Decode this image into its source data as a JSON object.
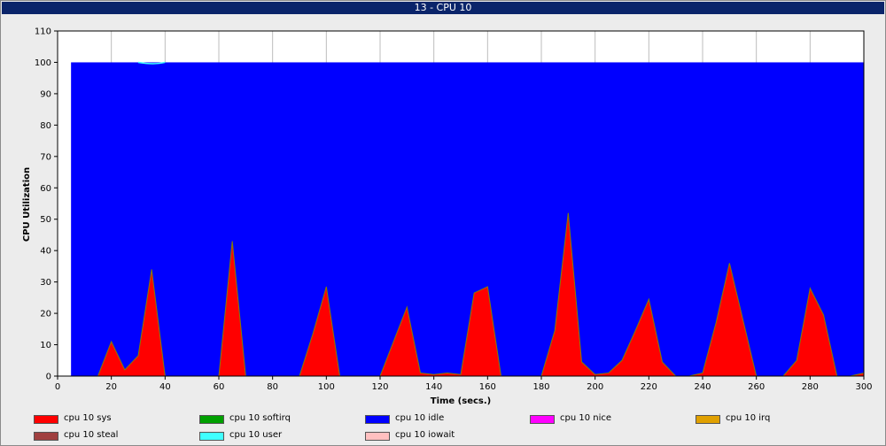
{
  "window": {
    "title": "13 - CPU 10"
  },
  "chart_data": {
    "type": "area",
    "title": "",
    "xlabel": "Time (secs.)",
    "ylabel": "CPU Utilization",
    "xlim": [
      0,
      300
    ],
    "ylim": [
      0,
      110
    ],
    "xticks": [
      0,
      20,
      40,
      60,
      80,
      100,
      120,
      140,
      160,
      180,
      200,
      220,
      240,
      260,
      280,
      300
    ],
    "yticks": [
      0,
      10,
      20,
      30,
      40,
      50,
      60,
      70,
      80,
      90,
      100,
      110
    ],
    "grid": true,
    "legend_position": "bottom",
    "x": [
      5,
      10,
      15,
      20,
      25,
      30,
      35,
      40,
      45,
      50,
      55,
      60,
      65,
      70,
      75,
      80,
      85,
      90,
      95,
      100,
      105,
      110,
      115,
      120,
      125,
      130,
      135,
      140,
      145,
      150,
      155,
      160,
      165,
      170,
      175,
      180,
      185,
      190,
      195,
      200,
      205,
      210,
      215,
      220,
      225,
      230,
      235,
      240,
      245,
      250,
      255,
      260,
      265,
      270,
      275,
      280,
      285,
      290,
      295,
      300
    ],
    "series": [
      {
        "name": "cpu 10 sys",
        "color": "#ff0000",
        "values": [
          0,
          0,
          0,
          11,
          2,
          6.5,
          34,
          0,
          0,
          0,
          0,
          0,
          43,
          0,
          0,
          0,
          0,
          0,
          13.5,
          28.5,
          0,
          0,
          0,
          0,
          11,
          22,
          1,
          0.5,
          1,
          0.5,
          26.5,
          28.5,
          0,
          0,
          0,
          0,
          14.5,
          52,
          4.5,
          0.5,
          1,
          5,
          14.5,
          24.5,
          4.5,
          0,
          0,
          1,
          17,
          36,
          18,
          0,
          0,
          0,
          5,
          28,
          19.5,
          0,
          0,
          1
        ]
      },
      {
        "name": "cpu 10 softirq",
        "color": "#00a000",
        "values": []
      },
      {
        "name": "cpu 10 idle",
        "color": "#0000ff",
        "values": []
      },
      {
        "name": "cpu 10 nice",
        "color": "#ff00ff",
        "values": []
      },
      {
        "name": "cpu 10 irq",
        "color": "#e0a000",
        "values": []
      },
      {
        "name": "cpu 10 steal",
        "color": "#a04040",
        "values": []
      },
      {
        "name": "cpu 10 user",
        "color": "#40ffff",
        "values": []
      },
      {
        "name": "cpu 10 iowait",
        "color": "#ffc0c0",
        "values": []
      }
    ],
    "idle_fill_top": 100
  }
}
